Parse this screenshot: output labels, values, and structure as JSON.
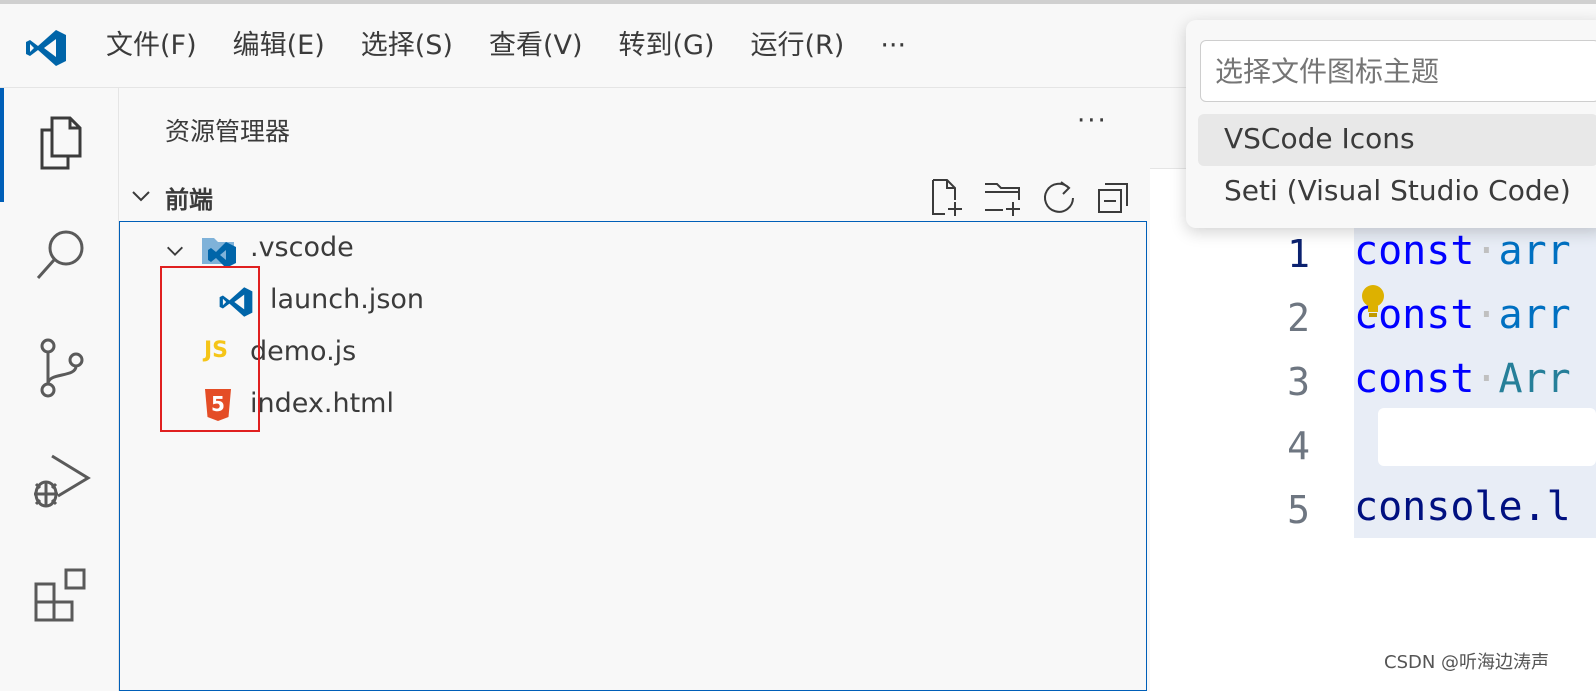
{
  "menu": {
    "items": [
      {
        "label": "文件(F)"
      },
      {
        "label": "编辑(E)"
      },
      {
        "label": "选择(S)"
      },
      {
        "label": "查看(V)"
      },
      {
        "label": "转到(G)"
      },
      {
        "label": "运行(R)"
      },
      {
        "label": "···"
      }
    ]
  },
  "sidebar": {
    "title": "资源管理器",
    "more": "···",
    "section": {
      "name": "前端"
    },
    "tree": [
      {
        "label": ".vscode",
        "icon": "vscode-folder-icon"
      },
      {
        "label": "launch.json",
        "icon": "vscode-file-icon"
      },
      {
        "label": "demo.js",
        "icon": "js-file-icon",
        "badge": "JS"
      },
      {
        "label": "index.html",
        "icon": "html5-file-icon",
        "badge": "5"
      }
    ]
  },
  "editor": {
    "lines": [
      {
        "number": "1",
        "keyword": "const",
        "rest": "arr"
      },
      {
        "number": "2",
        "keyword": "const",
        "rest": "arr"
      },
      {
        "number": "3",
        "keyword": "const",
        "rest": "Arr"
      },
      {
        "number": "4",
        "keyword": "",
        "rest": ""
      },
      {
        "number": "5",
        "keyword": "",
        "rest": "console.l"
      }
    ]
  },
  "quickpick": {
    "placeholder": "选择文件图标主题",
    "items": [
      {
        "label": "VSCode Icons"
      },
      {
        "label": "Seti (Visual Studio Code)"
      }
    ]
  },
  "watermark": "CSDN @听海边涛声",
  "colors": {
    "accent": "#005fb8",
    "highlight": "#e02020",
    "js": "#f5c518",
    "html": "#e44d26",
    "vscodeBlue": "#0065a9"
  }
}
